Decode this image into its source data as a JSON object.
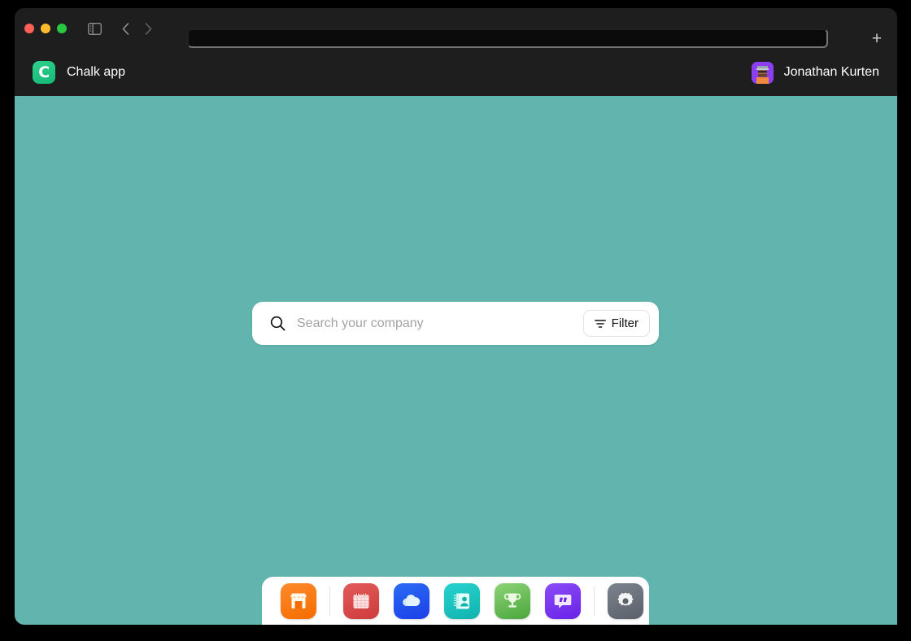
{
  "browser": {
    "traffic_lights": [
      "close",
      "minimize",
      "maximize"
    ],
    "sidebar_toggle_icon": "sidebar-toggle-icon",
    "back_icon": "chevron-left-icon",
    "forward_icon": "chevron-right-icon",
    "address_value": "",
    "new_tab_label": "+"
  },
  "header": {
    "logo_letter": "C",
    "app_name": "Chalk app",
    "user_name": "Jonathan Kurten",
    "avatar_icon": "user-avatar"
  },
  "search": {
    "placeholder": "Search your company",
    "value": "",
    "icon": "search-icon",
    "filter_label": "Filter",
    "filter_icon": "filter-icon"
  },
  "dock": {
    "items": [
      {
        "name": "storefront",
        "icon": "storefront-icon",
        "color": "#f56c00"
      },
      {
        "type": "divider"
      },
      {
        "name": "calendar",
        "icon": "calendar-icon",
        "color": "#cf3b3b"
      },
      {
        "name": "cloud",
        "icon": "cloud-icon",
        "color": "#1c3fe8"
      },
      {
        "name": "contacts",
        "icon": "contacts-icon",
        "color": "#11b3ae"
      },
      {
        "name": "trophy",
        "icon": "trophy-icon",
        "color": "#4aa63c"
      },
      {
        "name": "chat",
        "icon": "chat-quote-icon",
        "color": "#6a21e8"
      },
      {
        "type": "divider"
      },
      {
        "name": "settings",
        "icon": "gear-icon",
        "color": "#5a6069"
      }
    ]
  },
  "theme": {
    "canvas_color": "#61b5ae",
    "chrome_color": "#1e1e1e",
    "accent_color": "#14b877"
  }
}
